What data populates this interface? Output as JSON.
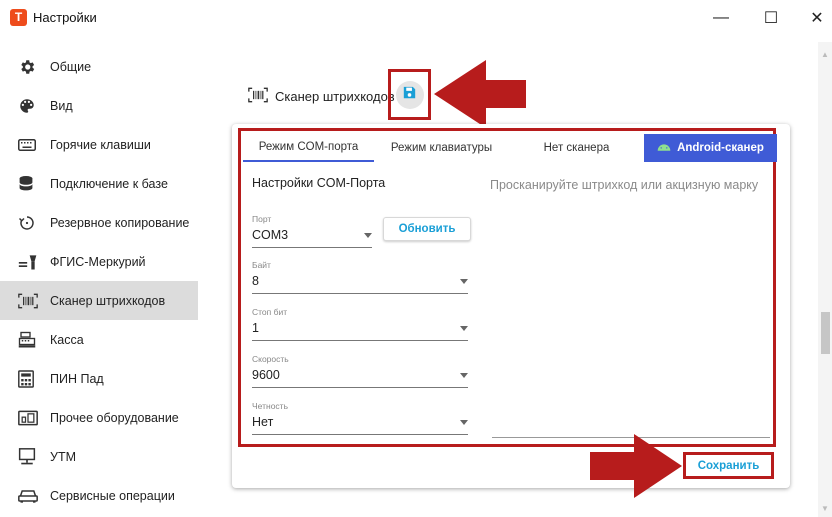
{
  "window": {
    "app_logo": "Т",
    "title": "Настройки",
    "minimize": "—",
    "maximize": "☐",
    "close": "✕"
  },
  "sidebar": {
    "items": [
      {
        "label": "Общие",
        "icon": "gear-icon"
      },
      {
        "label": "Вид",
        "icon": "palette-icon"
      },
      {
        "label": "Горячие клавиши",
        "icon": "keyboard-icon"
      },
      {
        "label": "Подключение к базе",
        "icon": "database-icon"
      },
      {
        "label": "Резервное копирование",
        "icon": "backup-icon"
      },
      {
        "label": "ФГИС-Меркурий",
        "icon": "mercury-icon"
      },
      {
        "label": "Сканер штрихкодов",
        "icon": "barcode-icon",
        "active": true
      },
      {
        "label": "Касса",
        "icon": "cash-register-icon"
      },
      {
        "label": "ПИН Пад",
        "icon": "pinpad-icon"
      },
      {
        "label": "Прочее оборудование",
        "icon": "devices-icon"
      },
      {
        "label": "УТМ",
        "icon": "monitor-icon"
      },
      {
        "label": "Сервисные операции",
        "icon": "car-icon"
      }
    ]
  },
  "header": {
    "title": "Сканер штрихкодов",
    "save_icon": "floppy-icon"
  },
  "tabs": [
    {
      "label": "Режим COM-порта",
      "active": true
    },
    {
      "label": "Режим клавиатуры"
    },
    {
      "label": "Нет сканера"
    },
    {
      "label": "Android-сканер",
      "highlight": true
    }
  ],
  "com_settings": {
    "title": "Настройки COM-Порта",
    "port": {
      "label": "Порт",
      "value": "COM3"
    },
    "refresh_label": "Обновить",
    "byte": {
      "label": "Байт",
      "value": "8"
    },
    "stop_bits": {
      "label": "Стоп бит",
      "value": "1"
    },
    "speed": {
      "label": "Скорость",
      "value": "9600"
    },
    "parity": {
      "label": "Четность",
      "value": "Нет"
    }
  },
  "scan_hint": "Просканируйте штрихкод или акцизную марку",
  "save_label": "Сохранить",
  "colors": {
    "accent": "#3f5bd6",
    "link": "#1a9fd6",
    "highlight_red": "#b71c1c",
    "logo": "#ee4c1c"
  }
}
